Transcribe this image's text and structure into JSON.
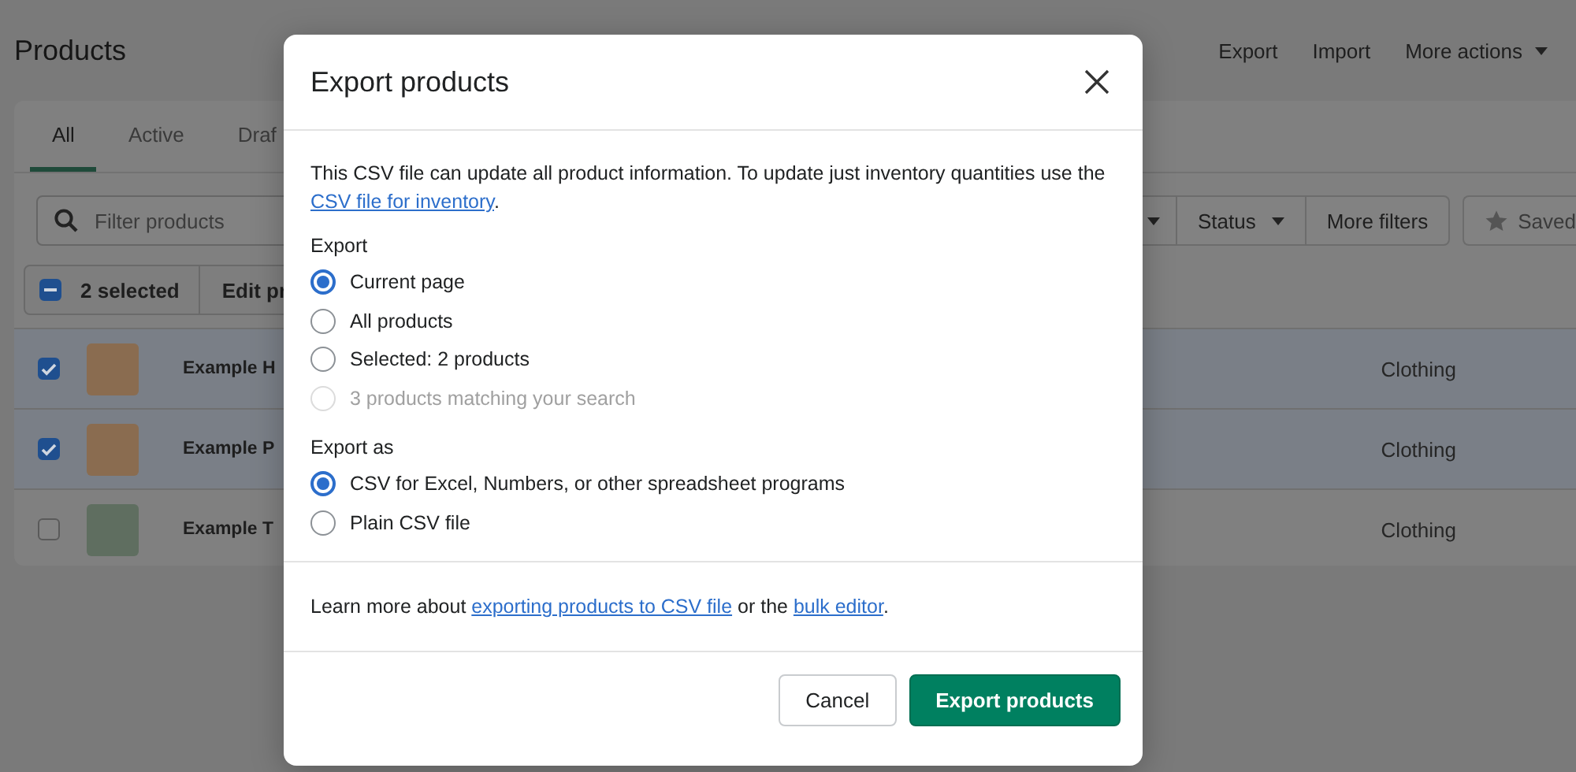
{
  "header": {
    "title": "Products",
    "actions": [
      {
        "label": "Export",
        "kind": "plain"
      },
      {
        "label": "Import",
        "kind": "plain"
      },
      {
        "label": "More actions",
        "kind": "menu"
      }
    ]
  },
  "tabs": [
    {
      "label": "All",
      "selected": true
    },
    {
      "label": "Active",
      "selected": false
    },
    {
      "label": "Draf",
      "selected": false
    }
  ],
  "filter": {
    "placeholder": "Filter products"
  },
  "filter_buttons": [
    {
      "kind": "caret"
    },
    {
      "kind": "menu",
      "label": "Status"
    },
    {
      "kind": "plain",
      "label": "More filters"
    },
    {
      "kind": "saved",
      "label": "Saved"
    }
  ],
  "bulk_bar": {
    "indeterminate": true,
    "count": "2 selected",
    "action": "Edit pr"
  },
  "rows": [
    {
      "name": "Example H",
      "type": "Clothing",
      "selected": true
    },
    {
      "name": "Example P",
      "type": "Clothing",
      "selected": true
    },
    {
      "name": "Example T",
      "type": "Clothing",
      "selected": false
    }
  ],
  "modal": {
    "title": "Export products",
    "intro": {
      "before": "This CSV file can update all product information. To update just inventory quantities use the",
      "link": "CSV file for inventory",
      "after": "."
    },
    "groups": [
      {
        "label": "Export",
        "options": [
          {
            "label": "Current page",
            "selected": true,
            "disabled": false
          },
          {
            "label": "All products",
            "selected": false,
            "disabled": false
          },
          {
            "label": "Selected: 2 products",
            "selected": false,
            "disabled": false
          },
          {
            "label": "3 products matching your search",
            "selected": false,
            "disabled": true
          }
        ]
      },
      {
        "label": "Export as",
        "options": [
          {
            "label": "CSV for Excel, Numbers, or other spreadsheet programs",
            "selected": true,
            "disabled": false
          },
          {
            "label": "Plain CSV file",
            "selected": false,
            "disabled": false
          }
        ]
      }
    ],
    "learn_more": {
      "before": "Learn more about",
      "link_1": "exporting products to CSV file",
      "middle": "or the",
      "link_2": "bulk editor",
      "after": "."
    },
    "buttons": [
      {
        "label": "Cancel",
        "kind": "secondary"
      },
      {
        "label": "Export products",
        "kind": "primary"
      }
    ]
  }
}
